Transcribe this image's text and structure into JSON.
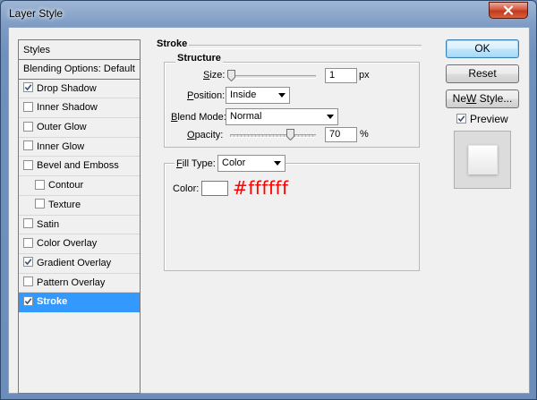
{
  "window": {
    "title": "Layer Style"
  },
  "styles_panel": {
    "header": "Styles",
    "items": [
      {
        "label": "Blending Options: Default",
        "checkbox": false,
        "checked": false,
        "indent": false,
        "selected": false
      },
      {
        "label": "Drop Shadow",
        "checkbox": true,
        "checked": true,
        "indent": false,
        "selected": false
      },
      {
        "label": "Inner Shadow",
        "checkbox": true,
        "checked": false,
        "indent": false,
        "selected": false
      },
      {
        "label": "Outer Glow",
        "checkbox": true,
        "checked": false,
        "indent": false,
        "selected": false
      },
      {
        "label": "Inner Glow",
        "checkbox": true,
        "checked": false,
        "indent": false,
        "selected": false
      },
      {
        "label": "Bevel and Emboss",
        "checkbox": true,
        "checked": false,
        "indent": false,
        "selected": false
      },
      {
        "label": "Contour",
        "checkbox": true,
        "checked": false,
        "indent": true,
        "selected": false
      },
      {
        "label": "Texture",
        "checkbox": true,
        "checked": false,
        "indent": true,
        "selected": false
      },
      {
        "label": "Satin",
        "checkbox": true,
        "checked": false,
        "indent": false,
        "selected": false
      },
      {
        "label": "Color Overlay",
        "checkbox": true,
        "checked": false,
        "indent": false,
        "selected": false
      },
      {
        "label": "Gradient Overlay",
        "checkbox": true,
        "checked": true,
        "indent": false,
        "selected": false
      },
      {
        "label": "Pattern Overlay",
        "checkbox": true,
        "checked": false,
        "indent": false,
        "selected": false
      },
      {
        "label": "Stroke",
        "checkbox": true,
        "checked": true,
        "indent": false,
        "selected": true
      }
    ]
  },
  "stroke": {
    "title": "Stroke",
    "structure_title": "Structure",
    "size": {
      "label_u": "S",
      "label_rest": "ize:",
      "value": "1",
      "unit": "px",
      "fraction": 0.01
    },
    "position": {
      "label_u": "P",
      "label_rest": "osition:",
      "value": "Inside"
    },
    "blend_mode": {
      "label_u": "B",
      "label_rest": "lend Mode:",
      "value": "Normal"
    },
    "opacity": {
      "label_u": "O",
      "label_rest": "pacity:",
      "value": "70",
      "unit": "%",
      "fraction": 0.7
    },
    "fill_type": {
      "label_u": "F",
      "label_rest": "ill Type:",
      "value": "Color"
    },
    "color": {
      "label": "Color:",
      "swatch": "#ffffff",
      "annotation": "#ffffff"
    }
  },
  "buttons": {
    "ok": "OK",
    "reset": "Reset",
    "new_style_u": "W",
    "new_style_pre": "Ne",
    "new_style_post": "",
    "new_style_rest": " Style...",
    "preview_label": "Preview",
    "preview_checked": true
  },
  "colors": {
    "selection": "#3399ff",
    "annotation": "#ff0000",
    "default_button_border": "#3c7fb1"
  }
}
